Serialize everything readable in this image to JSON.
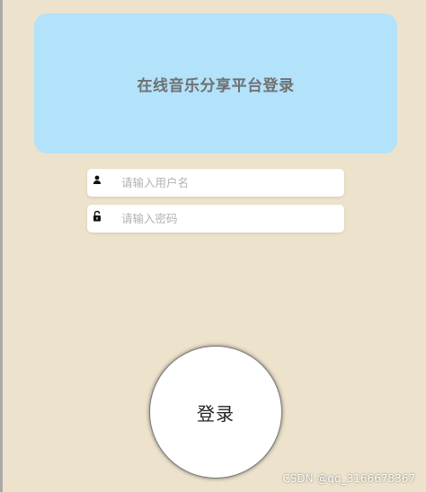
{
  "header": {
    "title": "在线音乐分享平台登录"
  },
  "form": {
    "username": {
      "placeholder": "请输入用户名",
      "value": "",
      "icon": "user-icon"
    },
    "password": {
      "placeholder": "请输入密码",
      "value": "",
      "icon": "lock-icon"
    },
    "login_label": "登录"
  },
  "watermark": "CSDN @qq_3166678367",
  "colors": {
    "background": "#ede3cc",
    "header_card": "#b3e2fb",
    "field_background": "#ffffff",
    "button_background": "#ffffff"
  }
}
